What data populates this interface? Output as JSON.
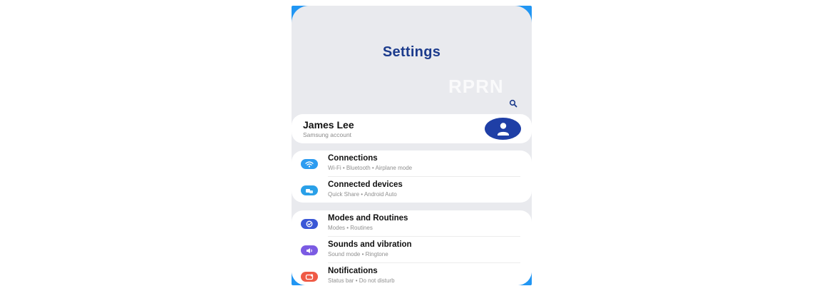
{
  "header": {
    "title": "Settings",
    "watermark": "RPRN"
  },
  "account": {
    "name": "James Lee",
    "subtitle": "Samsung account"
  },
  "groups": [
    {
      "items": [
        {
          "title": "Connections",
          "subtitle": "Wi-Fi  •  Bluetooth  •  Airplane mode",
          "icon": "wifi-icon",
          "color": "#2d9cf0"
        },
        {
          "title": "Connected devices",
          "subtitle": "Quick Share  •  Android Auto",
          "icon": "connected-devices-icon",
          "color": "#2aa0e8"
        }
      ]
    },
    {
      "items": [
        {
          "title": "Modes and Routines",
          "subtitle": "Modes  •  Routines",
          "icon": "modes-icon",
          "color": "#3a57d6"
        },
        {
          "title": "Sounds and vibration",
          "subtitle": "Sound mode  •  Ringtone",
          "icon": "sound-icon",
          "color": "#7b5be3"
        },
        {
          "title": "Notifications",
          "subtitle": "Status bar  •  Do not disturb",
          "icon": "notifications-icon",
          "color": "#ef5a46"
        }
      ]
    }
  ],
  "colors": {
    "frame": "#2196f3",
    "title": "#1c3b8c",
    "avatar": "#1f3fa6",
    "background": "#e9eaee"
  }
}
